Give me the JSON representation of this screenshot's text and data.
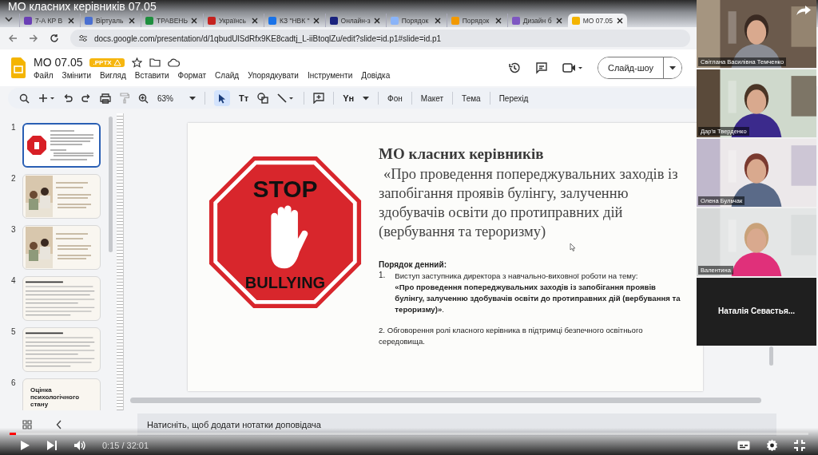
{
  "video": {
    "title": "МО класних керівників 07.05",
    "time": "0:15 / 32:01",
    "progress": {
      "level": 0.008
    }
  },
  "browser": {
    "tabs": [
      {
        "label": "7-А КР В",
        "color": "#6a3fb5",
        "selected": false
      },
      {
        "label": "Віртуаль",
        "color": "#4a6fd1",
        "selected": false
      },
      {
        "label": "ТРАВЕНЬ",
        "color": "#1e8e3e",
        "selected": false
      },
      {
        "label": "Українсь",
        "color": "#c5221f",
        "selected": false
      },
      {
        "label": "КЗ \"НВК \"",
        "color": "#1a73e8",
        "selected": false
      },
      {
        "label": "Онлайн-з",
        "color": "#1a237e",
        "selected": false
      },
      {
        "label": "Порядок",
        "color": "#8ab4f8",
        "selected": false
      },
      {
        "label": "Порядок",
        "color": "#f29900",
        "selected": false
      },
      {
        "label": "Дизайн б",
        "color": "#7e57c2",
        "selected": false
      },
      {
        "label": "МО 07.05",
        "color": "#f4b400",
        "selected": true
      }
    ],
    "url": "docs.google.com/presentation/d/1qbudUlSdRfx9KE8cadtj_L-iiBtoqlZu/edit?slide=id.p1#slide=id.p1"
  },
  "docs": {
    "title": "МО 07.05",
    "badge": ".PPTX",
    "menu": [
      "Файл",
      "Змінити",
      "Вигляд",
      "Вставити",
      "Формат",
      "Слайд",
      "Упорядкувати",
      "Інструменти",
      "Довідка"
    ],
    "zoom": "63%",
    "text_tool": "Tт",
    "input_tool": "Yн",
    "toolbar_buttons": [
      "Фон",
      "Макет",
      "Тема",
      "Перехід"
    ],
    "slideshow": "Слайд-шоу"
  },
  "thumbnails": [
    {
      "number": "1",
      "kind": "stop",
      "selected": true
    },
    {
      "number": "2",
      "selected": false
    },
    {
      "number": "3",
      "selected": false
    },
    {
      "number": "4",
      "kind": "text",
      "selected": false
    },
    {
      "number": "5",
      "kind": "text",
      "selected": false
    },
    {
      "number": "6",
      "kind": "titled",
      "title": "Оцінка психологічного стану",
      "selected": false
    }
  ],
  "slide": {
    "sign_top": "STOP",
    "sign_bottom": "BULLYING",
    "title": "МО класних керівників",
    "subtitle": "«Про проведення попереджувальних заходів із запобігання проявів булінгу, залученню здобувачів освіти до протиправних дій (вербування та тероризму)",
    "agenda_heading": "Порядок денний:",
    "item_number": "1.",
    "item_intro": "Виступ заступника директора з навчально-виховної роботи на тему:",
    "item_topic": "**«Про проведення попереджувальних заходів із запобігання проявів булінгу, залученню здобувачів освіти до протиправних дій (вербування та тероризму)»**.",
    "item_two": "2. Обговорення ролі класного керівника в підтримці безпечного освітнього середовища."
  },
  "notes_placeholder": "Натисніть, щоб додати нотатки доповідача",
  "participants": [
    {
      "name": "Світлана Василівна Темченко",
      "kind": "video"
    },
    {
      "name": "Дар'я Тверденко",
      "kind": "video"
    },
    {
      "name": "Олена Бульчак",
      "kind": "video"
    },
    {
      "name": "Валентина",
      "kind": "video"
    },
    {
      "name": "Наталія Севастья...",
      "kind": "avatar"
    }
  ]
}
